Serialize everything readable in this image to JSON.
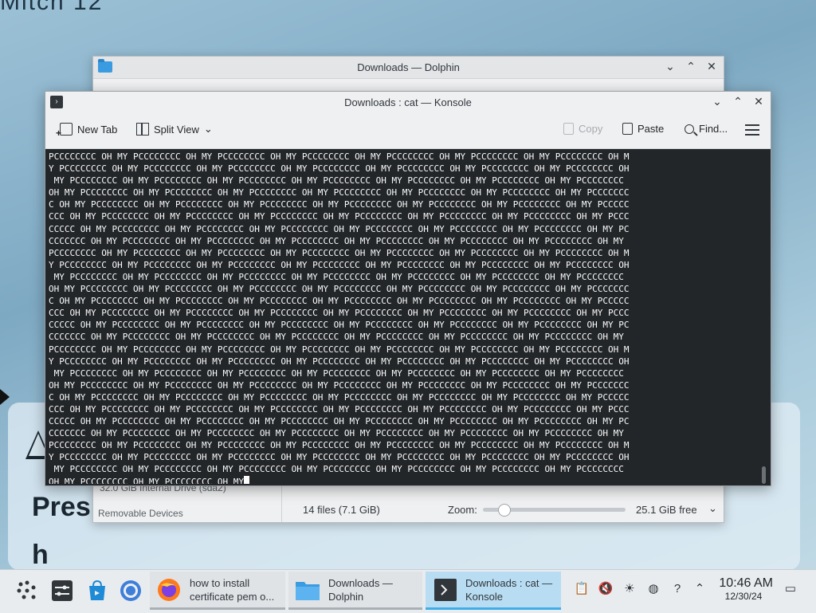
{
  "desktop": {
    "top_text": "Mitch 12",
    "top_right_text": "",
    "big_text_line1": "Pres",
    "big_text_line2": "h"
  },
  "dolphin": {
    "title": "Downloads — Dolphin",
    "drive_label": "32.0 GiB Internal Drive (sda2)",
    "removable_devices": "Removable Devices",
    "status_files": "14 files (7.1 GiB)",
    "zoom_label": "Zoom:",
    "zoom_level": 0.12,
    "free_space": "25.1 GiB free"
  },
  "konsole": {
    "title": "Downloads : cat — Konsole",
    "toolbar": {
      "new_tab": "New Tab",
      "split_view": "Split View",
      "copy": "Copy",
      "paste": "Paste",
      "find": "Find..."
    },
    "terminal_lines": [
      "PCCCCCCCC OH MY PCCCCCCCC OH MY PCCCCCCCC OH MY PCCCCCCCC OH MY PCCCCCCCC OH MY PCCCCCCCC OH MY PCCCCCCCC OH M",
      "Y PCCCCCCCC OH MY PCCCCCCCC OH MY PCCCCCCCC OH MY PCCCCCCCC OH MY PCCCCCCCC OH MY PCCCCCCCC OH MY PCCCCCCCC OH",
      " MY PCCCCCCCC OH MY PCCCCCCCC OH MY PCCCCCCCC OH MY PCCCCCCCC OH MY PCCCCCCCC OH MY PCCCCCCCC OH MY PCCCCCCCC",
      "OH MY PCCCCCCCC OH MY PCCCCCCCC OH MY PCCCCCCCC OH MY PCCCCCCCC OH MY PCCCCCCCC OH MY PCCCCCCCC OH MY PCCCCCCC",
      "C OH MY PCCCCCCCC OH MY PCCCCCCCC OH MY PCCCCCCCC OH MY PCCCCCCCC OH MY PCCCCCCCC OH MY PCCCCCCCC OH MY PCCCCC",
      "CCC OH MY PCCCCCCCC OH MY PCCCCCCCC OH MY PCCCCCCCC OH MY PCCCCCCCC OH MY PCCCCCCCC OH MY PCCCCCCCC OH MY PCCC",
      "CCCCC OH MY PCCCCCCCC OH MY PCCCCCCCC OH MY PCCCCCCCC OH MY PCCCCCCCC OH MY PCCCCCCCC OH MY PCCCCCCCC OH MY PC",
      "CCCCCCC OH MY PCCCCCCCC OH MY PCCCCCCCC OH MY PCCCCCCCC OH MY PCCCCCCCC OH MY PCCCCCCCC OH MY PCCCCCCCC OH MY",
      "PCCCCCCCC OH MY PCCCCCCCC OH MY PCCCCCCCC OH MY PCCCCCCCC OH MY PCCCCCCCC OH MY PCCCCCCCC OH MY PCCCCCCCC OH M",
      "Y PCCCCCCCC OH MY PCCCCCCCC OH MY PCCCCCCCC OH MY PCCCCCCCC OH MY PCCCCCCCC OH MY PCCCCCCCC OH MY PCCCCCCCC OH",
      " MY PCCCCCCCC OH MY PCCCCCCCC OH MY PCCCCCCCC OH MY PCCCCCCCC OH MY PCCCCCCCC OH MY PCCCCCCCC OH MY PCCCCCCCC",
      "OH MY PCCCCCCCC OH MY PCCCCCCCC OH MY PCCCCCCCC OH MY PCCCCCCCC OH MY PCCCCCCCC OH MY PCCCCCCCC OH MY PCCCCCCC",
      "C OH MY PCCCCCCCC OH MY PCCCCCCCC OH MY PCCCCCCCC OH MY PCCCCCCCC OH MY PCCCCCCCC OH MY PCCCCCCCC OH MY PCCCCC",
      "CCC OH MY PCCCCCCCC OH MY PCCCCCCCC OH MY PCCCCCCCC OH MY PCCCCCCCC OH MY PCCCCCCCC OH MY PCCCCCCCC OH MY PCCC",
      "CCCCC OH MY PCCCCCCCC OH MY PCCCCCCCC OH MY PCCCCCCCC OH MY PCCCCCCCC OH MY PCCCCCCCC OH MY PCCCCCCCC OH MY PC",
      "CCCCCCC OH MY PCCCCCCCC OH MY PCCCCCCCC OH MY PCCCCCCCC OH MY PCCCCCCCC OH MY PCCCCCCCC OH MY PCCCCCCCC OH MY",
      "PCCCCCCCC OH MY PCCCCCCCC OH MY PCCCCCCCC OH MY PCCCCCCCC OH MY PCCCCCCCC OH MY PCCCCCCCC OH MY PCCCCCCCC OH M",
      "Y PCCCCCCCC OH MY PCCCCCCCC OH MY PCCCCCCCC OH MY PCCCCCCCC OH MY PCCCCCCCC OH MY PCCCCCCCC OH MY PCCCCCCCC OH",
      " MY PCCCCCCCC OH MY PCCCCCCCC OH MY PCCCCCCCC OH MY PCCCCCCCC OH MY PCCCCCCCC OH MY PCCCCCCCC OH MY PCCCCCCCC",
      "OH MY PCCCCCCCC OH MY PCCCCCCCC OH MY PCCCCCCCC OH MY PCCCCCCCC OH MY PCCCCCCCC OH MY PCCCCCCCC OH MY PCCCCCCC",
      "C OH MY PCCCCCCCC OH MY PCCCCCCCC OH MY PCCCCCCCC OH MY PCCCCCCCC OH MY PCCCCCCCC OH MY PCCCCCCCC OH MY PCCCCC",
      "CCC OH MY PCCCCCCCC OH MY PCCCCCCCC OH MY PCCCCCCCC OH MY PCCCCCCCC OH MY PCCCCCCCC OH MY PCCCCCCCC OH MY PCCC",
      "CCCCC OH MY PCCCCCCCC OH MY PCCCCCCCC OH MY PCCCCCCCC OH MY PCCCCCCCC OH MY PCCCCCCCC OH MY PCCCCCCCC OH MY PC",
      "CCCCCCC OH MY PCCCCCCCC OH MY PCCCCCCCC OH MY PCCCCCCCC OH MY PCCCCCCCC OH MY PCCCCCCCC OH MY PCCCCCCCC OH MY",
      "PCCCCCCCC OH MY PCCCCCCCC OH MY PCCCCCCCC OH MY PCCCCCCCC OH MY PCCCCCCCC OH MY PCCCCCCCC OH MY PCCCCCCCC OH M",
      "Y PCCCCCCCC OH MY PCCCCCCCC OH MY PCCCCCCCC OH MY PCCCCCCCC OH MY PCCCCCCCC OH MY PCCCCCCCC OH MY PCCCCCCCC OH",
      " MY PCCCCCCCC OH MY PCCCCCCCC OH MY PCCCCCCCC OH MY PCCCCCCCC OH MY PCCCCCCCC OH MY PCCCCCCCC OH MY PCCCCCCCC",
      "OH MY PCCCCCCCC OH MY PCCCCCCCC OH MY"
    ]
  },
  "taskbar": {
    "tasks": [
      {
        "label": "how to install certificate pem o...",
        "line1": "how to install",
        "line2": "certificate pem o..."
      },
      {
        "label": "Downloads — Dolphin",
        "line1": "Downloads —",
        "line2": "Dolphin"
      },
      {
        "label": "Downloads : cat — Konsole",
        "line1": "Downloads : cat —",
        "line2": "Konsole"
      }
    ],
    "time": "10:46 AM",
    "date": "12/30/24"
  },
  "colors": {
    "terminal_bg": "#232629",
    "terminal_fg": "#fcfcfc",
    "accent": "#3daee9",
    "active_task_bg": "#b8dcf2"
  }
}
